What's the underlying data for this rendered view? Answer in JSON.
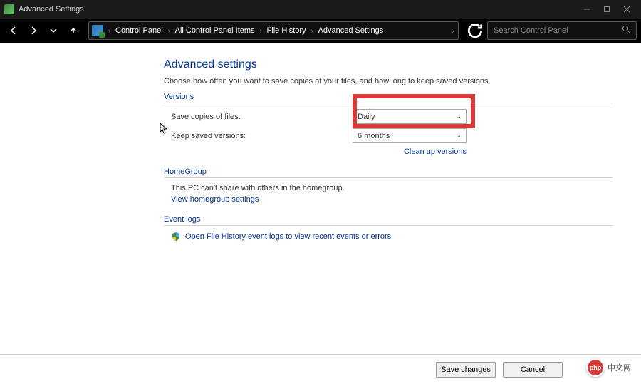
{
  "window": {
    "title": "Advanced Settings"
  },
  "breadcrumb": {
    "items": [
      "Control Panel",
      "All Control Panel Items",
      "File History",
      "Advanced Settings"
    ]
  },
  "search": {
    "placeholder": "Search Control Panel"
  },
  "page": {
    "title": "Advanced settings",
    "description": "Choose how often you want to save copies of your files, and how long to keep saved versions."
  },
  "versions": {
    "label": "Versions",
    "save_copies_label": "Save copies of files:",
    "save_copies_value": "Daily",
    "keep_versions_label": "Keep saved versions:",
    "keep_versions_value": "6 months",
    "cleanup_link": "Clean up versions"
  },
  "homegroup": {
    "label": "HomeGroup",
    "text": "This PC can't share with others in the homegroup.",
    "link": "View homegroup settings"
  },
  "eventlogs": {
    "label": "Event logs",
    "link": "Open File History event logs to view recent events or errors"
  },
  "footer": {
    "save": "Save changes",
    "cancel": "Cancel"
  },
  "watermark": {
    "logo": "php",
    "text": "中文网"
  }
}
